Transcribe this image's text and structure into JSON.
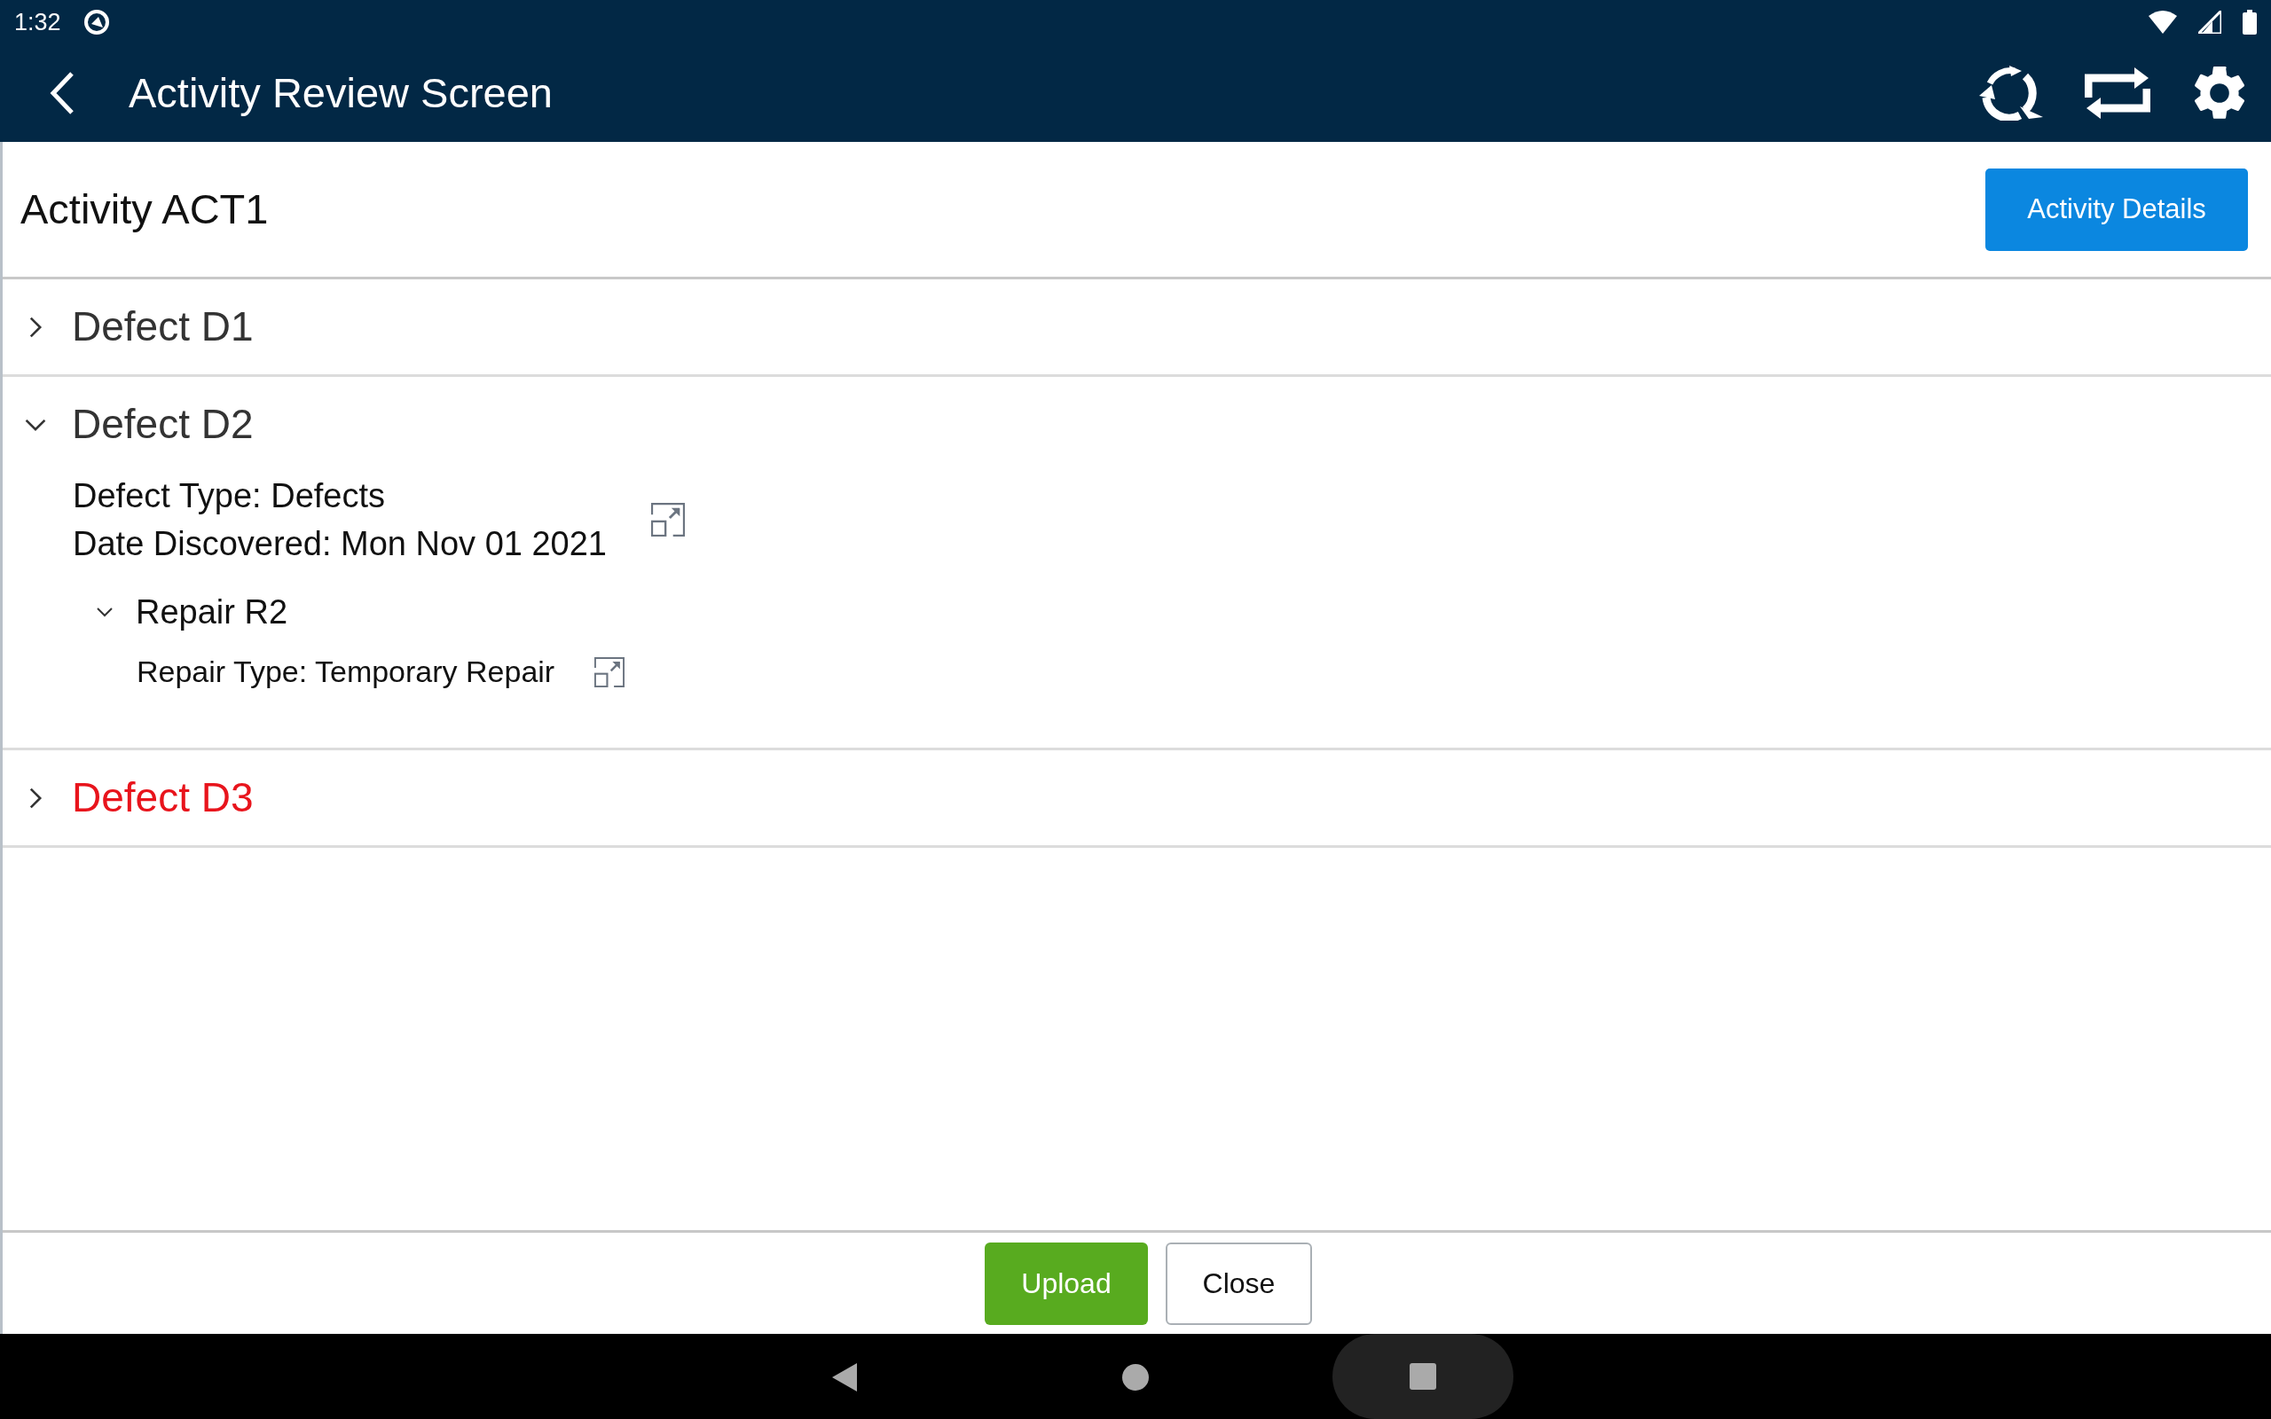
{
  "status_bar": {
    "time": "1:32"
  },
  "app_bar": {
    "title": "Activity Review Screen"
  },
  "activity": {
    "title": "Activity ACT1",
    "details_button": "Activity Details"
  },
  "defects": [
    {
      "title": "Defect D1",
      "expanded": false,
      "alert": false
    },
    {
      "title": "Defect D2",
      "expanded": true,
      "alert": false,
      "fields": [
        "Defect Type: Defects",
        "Date Discovered: Mon Nov 01 2021"
      ],
      "repairs": [
        {
          "title": "Repair R2",
          "expanded": true,
          "fields": [
            "Repair Type: Temporary Repair"
          ]
        }
      ]
    },
    {
      "title": "Defect D3",
      "expanded": false,
      "alert": true
    }
  ],
  "buttons": [
    {
      "label": "Upload",
      "kind": "primary"
    },
    {
      "label": "Close",
      "kind": "secondary"
    }
  ]
}
